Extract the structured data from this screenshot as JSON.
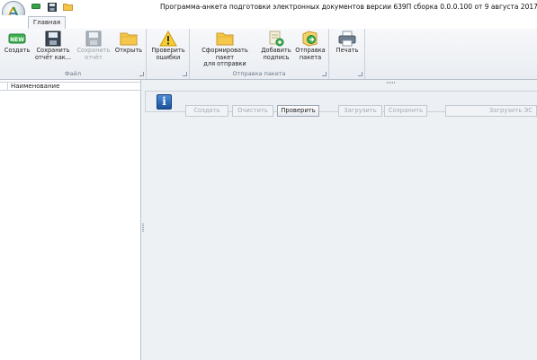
{
  "window": {
    "title": "Программа-анкета подготовки электронных документов версии 639П сборка 0.0.0.100 от 9 августа 2017 года."
  },
  "ribbon": {
    "tab_main": "Главная",
    "groups": {
      "file": {
        "label": "Файл",
        "buttons": {
          "create": {
            "line1": "Создать",
            "line2": "",
            "badge": "NEW"
          },
          "save_as": {
            "line1": "Сохранить",
            "line2": "отчёт как..."
          },
          "save": {
            "line1": "Сохранить",
            "line2": "отчёт"
          },
          "open": {
            "line1": "Открыть",
            "line2": ""
          }
        }
      },
      "check": {
        "label": "",
        "buttons": {
          "check_errors": {
            "line1": "Проверить",
            "line2": "ошибки"
          }
        }
      },
      "send": {
        "label": "Отправка пакета",
        "buttons": {
          "build_package": {
            "line1": "Сформировать пакет",
            "line2": "для отправки"
          },
          "add_signature": {
            "line1": "Добавить",
            "line2": "подпись"
          },
          "send_package": {
            "line1": "Отправка",
            "line2": "пакета"
          }
        }
      },
      "print": {
        "label": "",
        "buttons": {
          "print": {
            "line1": "Печать",
            "line2": ""
          }
        }
      }
    }
  },
  "left_pane": {
    "column_header": "Наименование"
  },
  "editor_panel": {
    "buttons": {
      "create": "Создать",
      "clear": "Очистить",
      "check": "Проверить",
      "load": "Загрузить",
      "save": "Сохранить",
      "load_es": "Загрузить ЭС"
    }
  },
  "colors": {
    "ribbon_bg": "#eef1f4",
    "border": "#b6c0cb",
    "info_blue": "#1b4f9c"
  }
}
